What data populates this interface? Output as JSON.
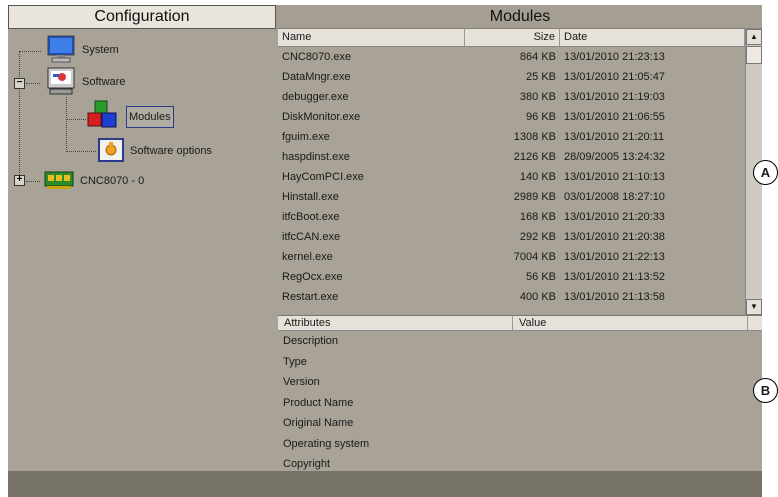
{
  "left_panel": {
    "title": "Configuration",
    "tree": [
      {
        "label": "System",
        "icon": "monitor-icon"
      },
      {
        "label": "Software",
        "icon": "software-computer-icon"
      },
      {
        "label": "Modules",
        "icon": "modules-cubes-icon"
      },
      {
        "label": "Software options",
        "icon": "software-options-icon"
      },
      {
        "label": "CNC8070 - 0",
        "icon": "cnc-board-icon"
      }
    ]
  },
  "modules": {
    "title": "Modules",
    "columns": {
      "name": "Name",
      "size": "Size",
      "date": "Date"
    },
    "rows": [
      {
        "name": "CNC8070.exe",
        "size": "864 KB",
        "date": "13/01/2010  21:23:13"
      },
      {
        "name": "DataMngr.exe",
        "size": "25 KB",
        "date": "13/01/2010  21:05:47"
      },
      {
        "name": "debugger.exe",
        "size": "380 KB",
        "date": "13/01/2010  21:19:03"
      },
      {
        "name": "DiskMonitor.exe",
        "size": "96 KB",
        "date": "13/01/2010  21:06:55"
      },
      {
        "name": "fguim.exe",
        "size": "1308 KB",
        "date": "13/01/2010  21:20:11"
      },
      {
        "name": "haspdinst.exe",
        "size": "2126 KB",
        "date": "28/09/2005  13:24:32"
      },
      {
        "name": "HayComPCI.exe",
        "size": "140 KB",
        "date": "13/01/2010  21:10:13"
      },
      {
        "name": "Hinstall.exe",
        "size": "2989 KB",
        "date": "03/01/2008  18:27:10"
      },
      {
        "name": "itfcBoot.exe",
        "size": "168 KB",
        "date": "13/01/2010  21:20:33"
      },
      {
        "name": "itfcCAN.exe",
        "size": "292 KB",
        "date": "13/01/2010  21:20:38"
      },
      {
        "name": "kernel.exe",
        "size": "7004 KB",
        "date": "13/01/2010  21:22:13"
      },
      {
        "name": "RegOcx.exe",
        "size": "56 KB",
        "date": "13/01/2010  21:13:52"
      },
      {
        "name": "Restart.exe",
        "size": "400 KB",
        "date": "13/01/2010  21:13:58"
      }
    ]
  },
  "attributes": {
    "columns": {
      "attributes": "Attributes",
      "value": "Value"
    },
    "rows": [
      "Description",
      "Type",
      "Version",
      "Product Name",
      "Original Name",
      "Operating system",
      "Copyright"
    ]
  },
  "callouts": {
    "a": "A",
    "b": "B"
  }
}
